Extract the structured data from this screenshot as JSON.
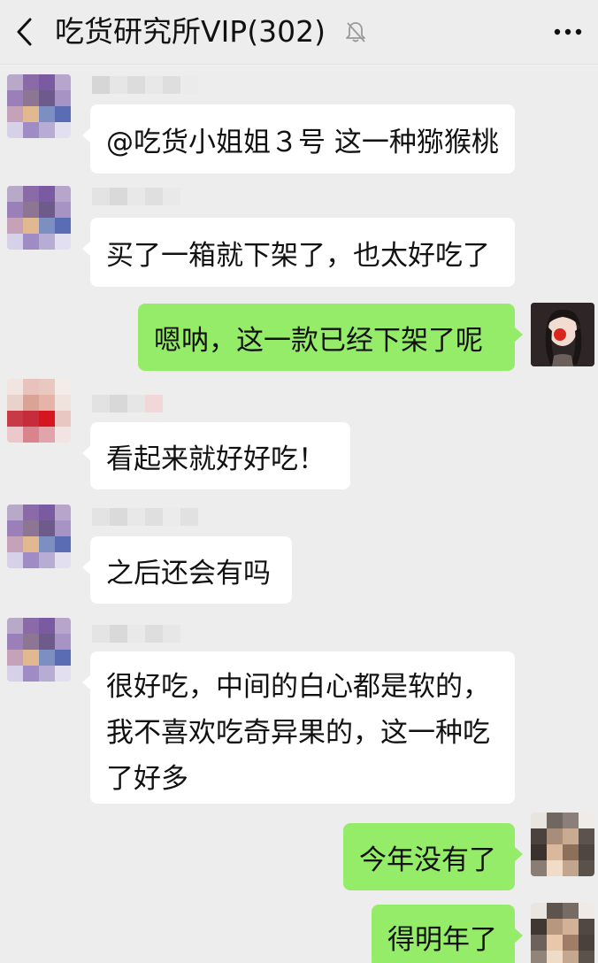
{
  "header": {
    "title": "吃货研究所VIP(302)",
    "back_icon": "chevron-left-icon",
    "mute_icon": "bell-muted-icon",
    "more_icon": "more-dots-icon"
  },
  "messages": [
    {
      "side": "in",
      "text": "@吃货小姐姐３号 这一种猕猴桃"
    },
    {
      "side": "in",
      "text": "买了一箱就下架了，也太好吃了"
    },
    {
      "side": "out",
      "text": "嗯呐，这一款已经下架了呢"
    },
    {
      "side": "in",
      "text": "看起来就好好吃！"
    },
    {
      "side": "in",
      "text": "之后还会有吗"
    },
    {
      "side": "in",
      "lines": [
        "很好吃，中间的白心都是软的，",
        "我不喜欢吃奇异果的，这一种吃",
        "了好多"
      ]
    },
    {
      "side": "out",
      "text": "今年没有了"
    },
    {
      "side": "out",
      "text": "得明年了"
    }
  ],
  "colors": {
    "background": "#ededed",
    "bubble_in": "#ffffff",
    "bubble_out": "#95ec69"
  }
}
